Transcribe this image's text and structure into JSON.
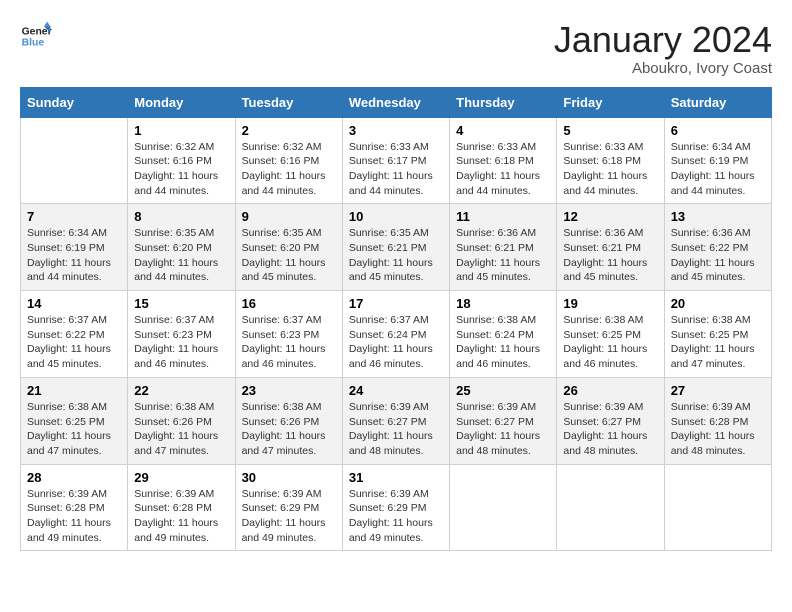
{
  "header": {
    "logo_line1": "General",
    "logo_line2": "Blue",
    "month": "January 2024",
    "location": "Aboukro, Ivory Coast"
  },
  "weekdays": [
    "Sunday",
    "Monday",
    "Tuesday",
    "Wednesday",
    "Thursday",
    "Friday",
    "Saturday"
  ],
  "weeks": [
    [
      {
        "day": "",
        "info": ""
      },
      {
        "day": "1",
        "info": "Sunrise: 6:32 AM\nSunset: 6:16 PM\nDaylight: 11 hours\nand 44 minutes."
      },
      {
        "day": "2",
        "info": "Sunrise: 6:32 AM\nSunset: 6:16 PM\nDaylight: 11 hours\nand 44 minutes."
      },
      {
        "day": "3",
        "info": "Sunrise: 6:33 AM\nSunset: 6:17 PM\nDaylight: 11 hours\nand 44 minutes."
      },
      {
        "day": "4",
        "info": "Sunrise: 6:33 AM\nSunset: 6:18 PM\nDaylight: 11 hours\nand 44 minutes."
      },
      {
        "day": "5",
        "info": "Sunrise: 6:33 AM\nSunset: 6:18 PM\nDaylight: 11 hours\nand 44 minutes."
      },
      {
        "day": "6",
        "info": "Sunrise: 6:34 AM\nSunset: 6:19 PM\nDaylight: 11 hours\nand 44 minutes."
      }
    ],
    [
      {
        "day": "7",
        "info": "Sunrise: 6:34 AM\nSunset: 6:19 PM\nDaylight: 11 hours\nand 44 minutes."
      },
      {
        "day": "8",
        "info": "Sunrise: 6:35 AM\nSunset: 6:20 PM\nDaylight: 11 hours\nand 44 minutes."
      },
      {
        "day": "9",
        "info": "Sunrise: 6:35 AM\nSunset: 6:20 PM\nDaylight: 11 hours\nand 45 minutes."
      },
      {
        "day": "10",
        "info": "Sunrise: 6:35 AM\nSunset: 6:21 PM\nDaylight: 11 hours\nand 45 minutes."
      },
      {
        "day": "11",
        "info": "Sunrise: 6:36 AM\nSunset: 6:21 PM\nDaylight: 11 hours\nand 45 minutes."
      },
      {
        "day": "12",
        "info": "Sunrise: 6:36 AM\nSunset: 6:21 PM\nDaylight: 11 hours\nand 45 minutes."
      },
      {
        "day": "13",
        "info": "Sunrise: 6:36 AM\nSunset: 6:22 PM\nDaylight: 11 hours\nand 45 minutes."
      }
    ],
    [
      {
        "day": "14",
        "info": "Sunrise: 6:37 AM\nSunset: 6:22 PM\nDaylight: 11 hours\nand 45 minutes."
      },
      {
        "day": "15",
        "info": "Sunrise: 6:37 AM\nSunset: 6:23 PM\nDaylight: 11 hours\nand 46 minutes."
      },
      {
        "day": "16",
        "info": "Sunrise: 6:37 AM\nSunset: 6:23 PM\nDaylight: 11 hours\nand 46 minutes."
      },
      {
        "day": "17",
        "info": "Sunrise: 6:37 AM\nSunset: 6:24 PM\nDaylight: 11 hours\nand 46 minutes."
      },
      {
        "day": "18",
        "info": "Sunrise: 6:38 AM\nSunset: 6:24 PM\nDaylight: 11 hours\nand 46 minutes."
      },
      {
        "day": "19",
        "info": "Sunrise: 6:38 AM\nSunset: 6:25 PM\nDaylight: 11 hours\nand 46 minutes."
      },
      {
        "day": "20",
        "info": "Sunrise: 6:38 AM\nSunset: 6:25 PM\nDaylight: 11 hours\nand 47 minutes."
      }
    ],
    [
      {
        "day": "21",
        "info": "Sunrise: 6:38 AM\nSunset: 6:25 PM\nDaylight: 11 hours\nand 47 minutes."
      },
      {
        "day": "22",
        "info": "Sunrise: 6:38 AM\nSunset: 6:26 PM\nDaylight: 11 hours\nand 47 minutes."
      },
      {
        "day": "23",
        "info": "Sunrise: 6:38 AM\nSunset: 6:26 PM\nDaylight: 11 hours\nand 47 minutes."
      },
      {
        "day": "24",
        "info": "Sunrise: 6:39 AM\nSunset: 6:27 PM\nDaylight: 11 hours\nand 48 minutes."
      },
      {
        "day": "25",
        "info": "Sunrise: 6:39 AM\nSunset: 6:27 PM\nDaylight: 11 hours\nand 48 minutes."
      },
      {
        "day": "26",
        "info": "Sunrise: 6:39 AM\nSunset: 6:27 PM\nDaylight: 11 hours\nand 48 minutes."
      },
      {
        "day": "27",
        "info": "Sunrise: 6:39 AM\nSunset: 6:28 PM\nDaylight: 11 hours\nand 48 minutes."
      }
    ],
    [
      {
        "day": "28",
        "info": "Sunrise: 6:39 AM\nSunset: 6:28 PM\nDaylight: 11 hours\nand 49 minutes."
      },
      {
        "day": "29",
        "info": "Sunrise: 6:39 AM\nSunset: 6:28 PM\nDaylight: 11 hours\nand 49 minutes."
      },
      {
        "day": "30",
        "info": "Sunrise: 6:39 AM\nSunset: 6:29 PM\nDaylight: 11 hours\nand 49 minutes."
      },
      {
        "day": "31",
        "info": "Sunrise: 6:39 AM\nSunset: 6:29 PM\nDaylight: 11 hours\nand 49 minutes."
      },
      {
        "day": "",
        "info": ""
      },
      {
        "day": "",
        "info": ""
      },
      {
        "day": "",
        "info": ""
      }
    ]
  ]
}
